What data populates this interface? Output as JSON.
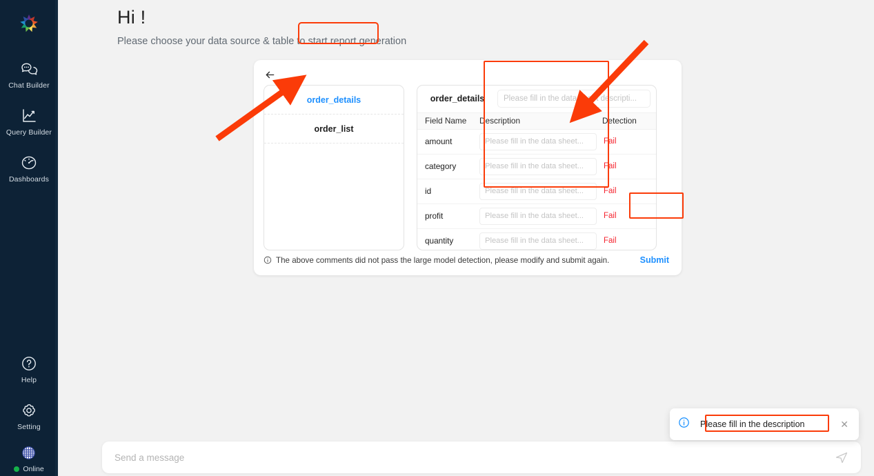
{
  "sidebar": {
    "logo_icon": "rainbow-flower-logo",
    "items": [
      {
        "label": "Chat Builder",
        "icon": "chat-bubbles-icon"
      },
      {
        "label": "Query Builder",
        "icon": "line-chart-icon"
      },
      {
        "label": "Dashboards",
        "icon": "gauge-icon"
      }
    ],
    "bottom_items": [
      {
        "label": "Help",
        "icon": "question-circle-icon"
      },
      {
        "label": "Setting",
        "icon": "gear-icon"
      }
    ],
    "status": {
      "label": "Online",
      "icon": "globe-icon",
      "dot_color": "#16b34a"
    }
  },
  "greeting": {
    "title": "Hi !",
    "subtitle": "Please choose your data source & table to start report generation"
  },
  "card": {
    "back_icon": "arrow-left-icon",
    "table_list": [
      {
        "name": "order_details",
        "active": true
      },
      {
        "name": "order_list",
        "active": false
      }
    ],
    "detail": {
      "table_name": "order_details",
      "sheet_description_placeholder": "Please fill in the data sheet descripti...",
      "columns": {
        "field_name": "Field Name",
        "description": "Description",
        "detection": "Detection"
      },
      "row_placeholder": "Please fill in the data sheet...",
      "rows": [
        {
          "field": "amount",
          "description": "",
          "detection": "Fail"
        },
        {
          "field": "category",
          "description": "",
          "detection": "Fail"
        },
        {
          "field": "id",
          "description": "",
          "detection": "Fail"
        },
        {
          "field": "profit",
          "description": "",
          "detection": "Fail"
        },
        {
          "field": "quantity",
          "description": "",
          "detection": "Fail"
        }
      ]
    },
    "footer": {
      "note_icon": "info-circle-icon",
      "note": "The above comments did not pass the large model detection, please modify and submit again.",
      "submit_label": "Submit"
    }
  },
  "chatbar": {
    "placeholder": "Send a message",
    "send_icon": "send-plane-icon"
  },
  "toast": {
    "icon": "info-circle-icon",
    "message": "Please fill in the description",
    "close_icon": "close-icon"
  },
  "annotations": {
    "highlight_color": "#fb3b08",
    "accent_blue": "#1e90ff",
    "fail_red": "#f5222d",
    "sidebar_bg": "#0d2236",
    "page_bg": "#f2f2f2"
  }
}
